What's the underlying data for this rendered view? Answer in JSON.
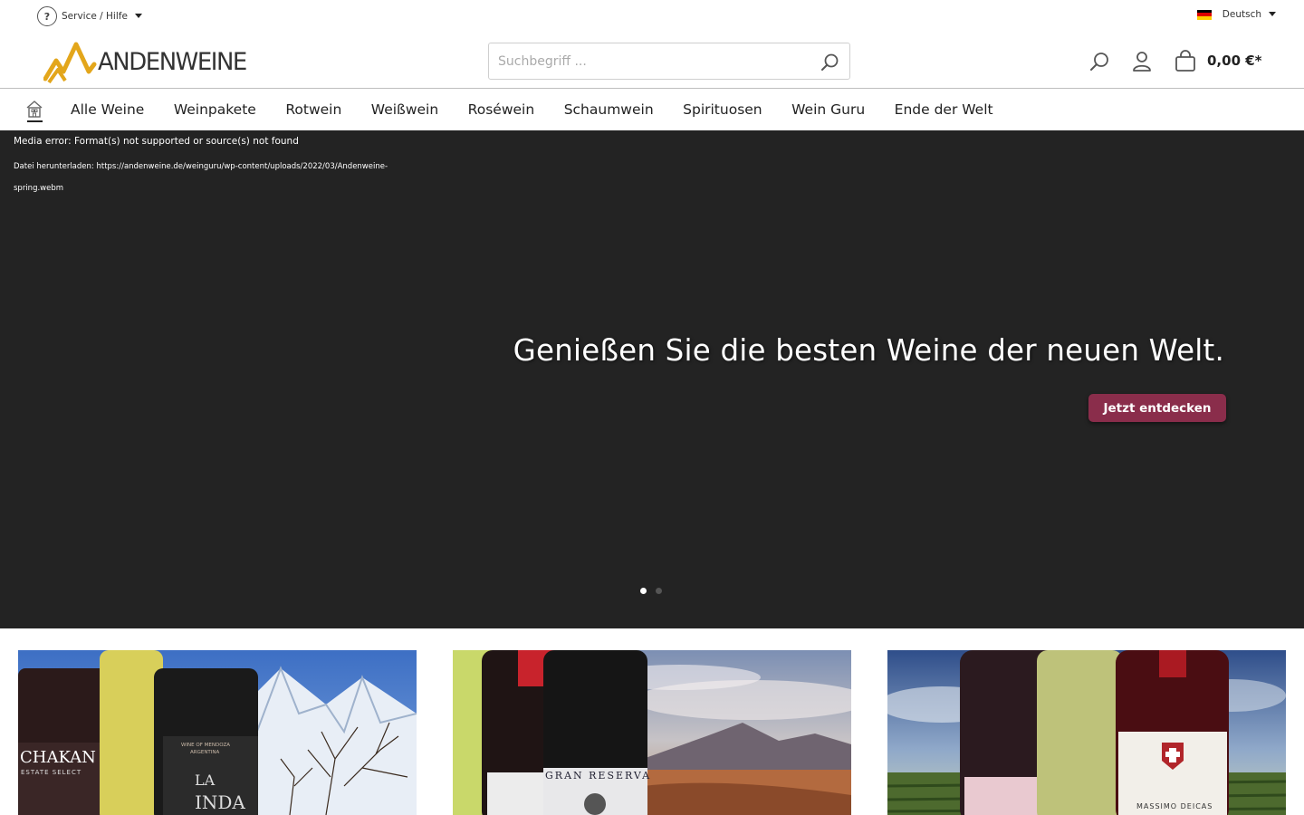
{
  "topbar": {
    "service_label": "Service / Hilfe",
    "service_icon": "question-icon",
    "language_label": "Deutsch",
    "language_flag": "flag-de-icon"
  },
  "header": {
    "logo_text": "ANDENWEINE",
    "search_placeholder": "Suchbegriff ...",
    "cart_total": "0,00 €*"
  },
  "nav": {
    "items": [
      {
        "label": "Alle Weine"
      },
      {
        "label": "Weinpakete"
      },
      {
        "label": "Rotwein"
      },
      {
        "label": "Weißwein"
      },
      {
        "label": "Roséwein"
      },
      {
        "label": "Schaumwein"
      },
      {
        "label": "Spirituosen"
      },
      {
        "label": "Wein Guru"
      },
      {
        "label": "Ende der Welt"
      }
    ]
  },
  "hero": {
    "media_error": "Media error: Format(s) not supported or source(s) not found",
    "download_text": "Datei herunterladen: https://andenweine.de/weinguru/wp-content/uploads/2022/03/Andenweine-spring.webm",
    "title": "Genießen Sie die besten Weine der neuen Welt.",
    "cta_label": "Jetzt entdecken",
    "slide_count": 2,
    "active_slide": 1
  },
  "tiles": [
    {
      "bottle_texts": [
        "CHAKAN",
        "ESTATE SELECT",
        "WINE OF MENDOZA",
        "ARGENTINA",
        "LA",
        "INDA"
      ]
    },
    {
      "bottle_texts": [
        "GRAN RESERVA"
      ]
    },
    {
      "bottle_texts": [
        "MASSIMO DEICAS"
      ]
    }
  ],
  "colors": {
    "accent": "#8a2d4b",
    "hero_bg": "#232323",
    "logo_gold": "#e3a61b"
  }
}
